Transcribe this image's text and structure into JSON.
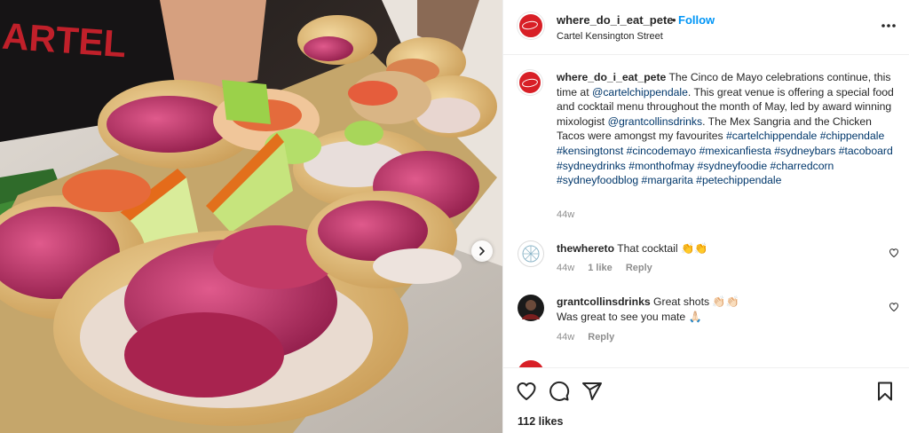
{
  "post": {
    "username": "where_do_i_eat_pete",
    "separator": "•",
    "follow_label": "Follow",
    "location": "Cartel Kensington Street",
    "photo_sign_text": "ARTEL"
  },
  "caption": {
    "username": "where_do_i_eat_pete",
    "part1": " The Cinco de Mayo celebrations continue, this time at ",
    "mention1": "@cartelchippendale",
    "part2": ". This great venue is offering a special food and cocktail menu throughout the month of May, led by award winning mixologist ",
    "mention2": "@grantcollinsdrinks",
    "part3": ". The Mex Sangria and the Chicken Tacos were amongst my favourites ",
    "hashtags": "#cartelchippendale #chippendale #kensingtonst #cincodemayo #mexicanfiesta #sydneybars #tacoboard #sydneydrinks #monthofmay #sydneyfoodie #charredcorn #sydneyfoodblog #margarita #petechippendale",
    "time": "44w"
  },
  "comments": [
    {
      "username": "thewhereto",
      "text": "That cocktail 👏👏",
      "time": "44w",
      "likes": "1 like",
      "reply_label": "Reply"
    },
    {
      "username": "grantcollinsdrinks",
      "text": "Great shots 👏🏻👏🏻",
      "text_line2": "Was great to see you mate 🙏🏻",
      "time": "44w",
      "reply_label": "Reply"
    }
  ],
  "likes_count": "112 likes",
  "icons": {
    "more": "more-options-icon",
    "like": "heart-icon",
    "comment": "comment-icon",
    "share": "share-icon",
    "save": "bookmark-icon",
    "next": "chevron-right-icon"
  },
  "colors": {
    "link_blue": "#0095f6",
    "hashtag": "#00376b",
    "muted": "#8e8e8e",
    "avatar_red": "#d81f26"
  }
}
